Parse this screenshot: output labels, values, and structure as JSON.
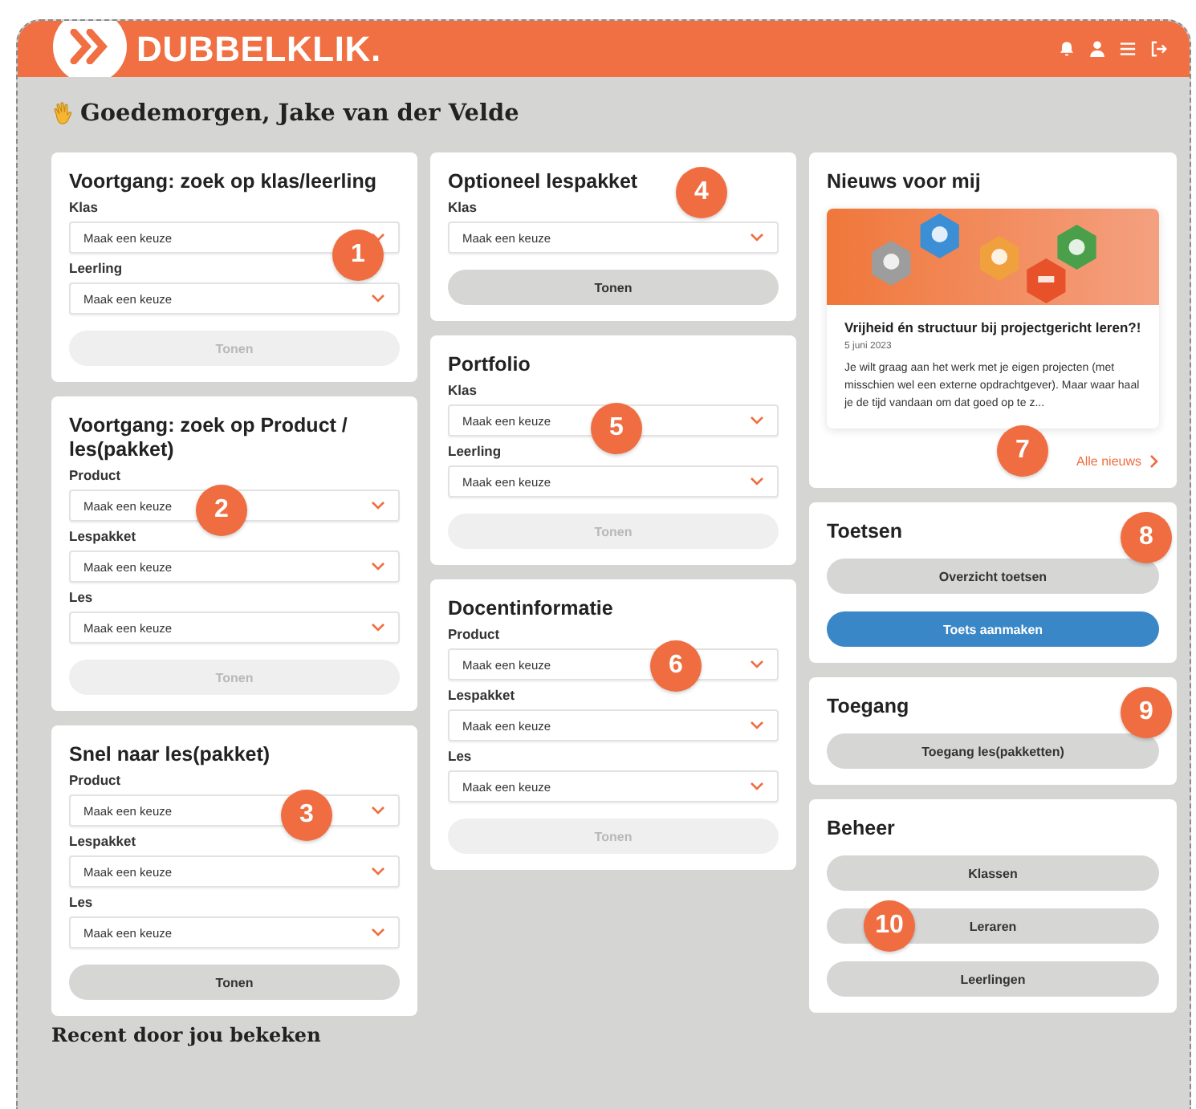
{
  "header": {
    "logo_text": "DUBBELKLIK."
  },
  "greeting": {
    "text": "Goedemorgen, Jake van der Velde"
  },
  "columns": [
    {
      "cards": [
        {
          "kind": "form",
          "callout": "1",
          "title": "Voortgang: zoek op klas/leerling",
          "fields": [
            {
              "label": "Klas",
              "placeholder": "Maak een keuze"
            },
            {
              "label": "Leerling",
              "placeholder": "Maak een keuze"
            }
          ],
          "button": {
            "label": "Tonen",
            "disabled": true
          }
        },
        {
          "kind": "form",
          "callout": "2",
          "title": "Voortgang: zoek op Product / les(pakket)",
          "fields": [
            {
              "label": "Product",
              "placeholder": "Maak een keuze"
            },
            {
              "label": "Lespakket",
              "placeholder": "Maak een keuze"
            },
            {
              "label": "Les",
              "placeholder": "Maak een keuze"
            }
          ],
          "button": {
            "label": "Tonen",
            "disabled": true
          }
        },
        {
          "kind": "form",
          "callout": "3",
          "title": "Snel naar les(pakket)",
          "fields": [
            {
              "label": "Product",
              "placeholder": "Maak een keuze"
            },
            {
              "label": "Lespakket",
              "placeholder": "Maak een keuze"
            },
            {
              "label": "Les",
              "placeholder": "Maak een keuze"
            }
          ],
          "button": {
            "label": "Tonen",
            "disabled": false
          }
        }
      ]
    },
    {
      "cards": [
        {
          "kind": "form",
          "callout": "4",
          "title": "Optioneel lespakket",
          "fields": [
            {
              "label": "Klas",
              "placeholder": "Maak een keuze"
            }
          ],
          "button": {
            "label": "Tonen",
            "disabled": false
          }
        },
        {
          "kind": "form",
          "callout": "5",
          "title": "Portfolio",
          "fields": [
            {
              "label": "Klas",
              "placeholder": "Maak een keuze"
            },
            {
              "label": "Leerling",
              "placeholder": "Maak een keuze"
            }
          ],
          "button": {
            "label": "Tonen",
            "disabled": true
          }
        },
        {
          "kind": "form",
          "callout": "6",
          "title": "Docentinformatie",
          "fields": [
            {
              "label": "Product",
              "placeholder": "Maak een keuze"
            },
            {
              "label": "Lespakket",
              "placeholder": "Maak een keuze"
            },
            {
              "label": "Les",
              "placeholder": "Maak een keuze"
            }
          ],
          "button": {
            "label": "Tonen",
            "disabled": true
          }
        }
      ]
    },
    {
      "cards": [
        {
          "kind": "news",
          "callout": "7",
          "title": "Nieuws voor mij",
          "article": {
            "title": "Vrijheid én structuur bij projectgericht leren?!",
            "date": "5 juni 2023",
            "excerpt": "Je wilt graag aan het werk met je eigen projecten (met misschien wel een externe opdrachtgever). Maar waar haal je de tijd vandaan om dat goed op te z..."
          },
          "link": "Alle nieuws"
        },
        {
          "kind": "actions",
          "callout": "8",
          "title": "Toetsen",
          "buttons": [
            {
              "label": "Overzicht toetsen",
              "primary": false
            },
            {
              "label": "Toets aanmaken",
              "primary": true
            }
          ]
        },
        {
          "kind": "actions",
          "callout": "9",
          "title": "Toegang",
          "buttons": [
            {
              "label": "Toegang les(pakketten)",
              "primary": false
            }
          ]
        },
        {
          "kind": "actions",
          "callout": "10",
          "title": "Beheer",
          "buttons": [
            {
              "label": "Klassen",
              "primary": false
            },
            {
              "label": "Leraren",
              "primary": false
            },
            {
              "label": "Leerlingen",
              "primary": false
            }
          ]
        }
      ]
    }
  ],
  "recent": {
    "title": "Recent door jou bekeken"
  }
}
